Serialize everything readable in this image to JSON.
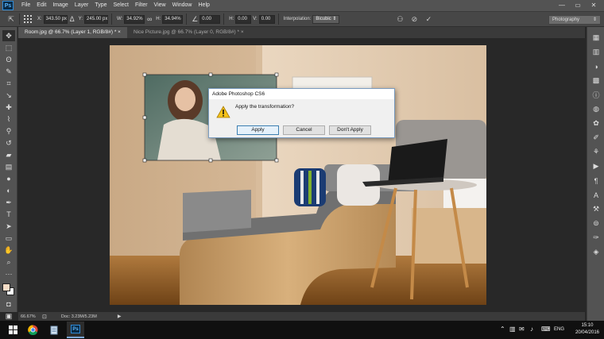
{
  "app": {
    "logo": "Ps",
    "window_controls": [
      "—",
      "▭",
      "✕"
    ]
  },
  "menu": [
    "File",
    "Edit",
    "Image",
    "Layer",
    "Type",
    "Select",
    "Filter",
    "View",
    "Window",
    "Help"
  ],
  "options": {
    "x_label": "X:",
    "x_value": "343.50 px",
    "y_label": "Y:",
    "y_value": "245.00 px",
    "w_label": "W:",
    "w_value": "34.92%",
    "h_label": "H:",
    "h_value": "34.94%",
    "angle_value": "0.00",
    "h_skew_label": "H:",
    "h_skew_value": "0.00",
    "v_skew_label": "V:",
    "v_skew_value": "0.00",
    "interpolation_label": "Interpolation:",
    "interpolation_value": "Bicubic",
    "workspace": "Photography"
  },
  "tabs": [
    {
      "label": "Room.jpg @ 66.7% (Layer 1, RGB/8#) *",
      "close": "×",
      "active": true
    },
    {
      "label": "Nice Picture.jpg @ 66.7% (Layer 0, RGB/8#) *",
      "close": "×",
      "active": false
    }
  ],
  "status": {
    "zoom": "66.67%",
    "doc": "Doc: 3.23M/5.23M"
  },
  "dialog": {
    "title": "Adobe Photoshop CS6",
    "message": "Apply the transformation?",
    "apply": "Apply",
    "cancel": "Cancel",
    "dont_apply": "Don't Apply"
  },
  "taskbar": {
    "time": "15:10",
    "date": "20/04/2016",
    "lang": "ENG"
  },
  "colors": {
    "foreground": "#f5dcc6",
    "background": "#ffffff",
    "accent": "#2f8bd8"
  }
}
